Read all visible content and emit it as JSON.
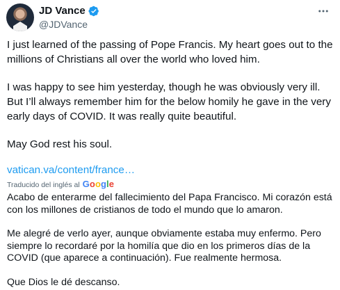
{
  "author": {
    "display_name": "JD Vance",
    "handle": "@JDVance",
    "verified_color": "#1d9bf0"
  },
  "icons": {
    "avatar": "profile-photo",
    "verified": "verified-badge-icon",
    "more": "more-horizontal-icon"
  },
  "tweet": {
    "paragraphs": [
      "I just learned of the passing of Pope Francis. My heart goes out to the millions of Christians all over the world who loved him.",
      "I was happy to see him yesterday, though he was obviously very ill. But I’ll always remember him for the below homily he gave in the very early days of COVID. It was really quite beautiful.",
      "May God rest his soul."
    ],
    "link_text": "vatican.va/content/france…",
    "link_color": "#1d9bf0"
  },
  "translation": {
    "label": "Traducido del inglés al",
    "provider_logo_text": "Google",
    "paragraphs": [
      "Acabo de enterarme del fallecimiento del Papa Francisco. Mi corazón está con los millones de cristianos de todo el mundo que lo amaron.",
      "Me alegré de verlo ayer, aunque obviamente estaba muy enfermo. Pero siempre lo recordaré por la homilía que dio en los primeros días de la COVID (que aparece a continuación). Fue realmente hermosa.",
      "Que Dios le dé descanso."
    ]
  }
}
